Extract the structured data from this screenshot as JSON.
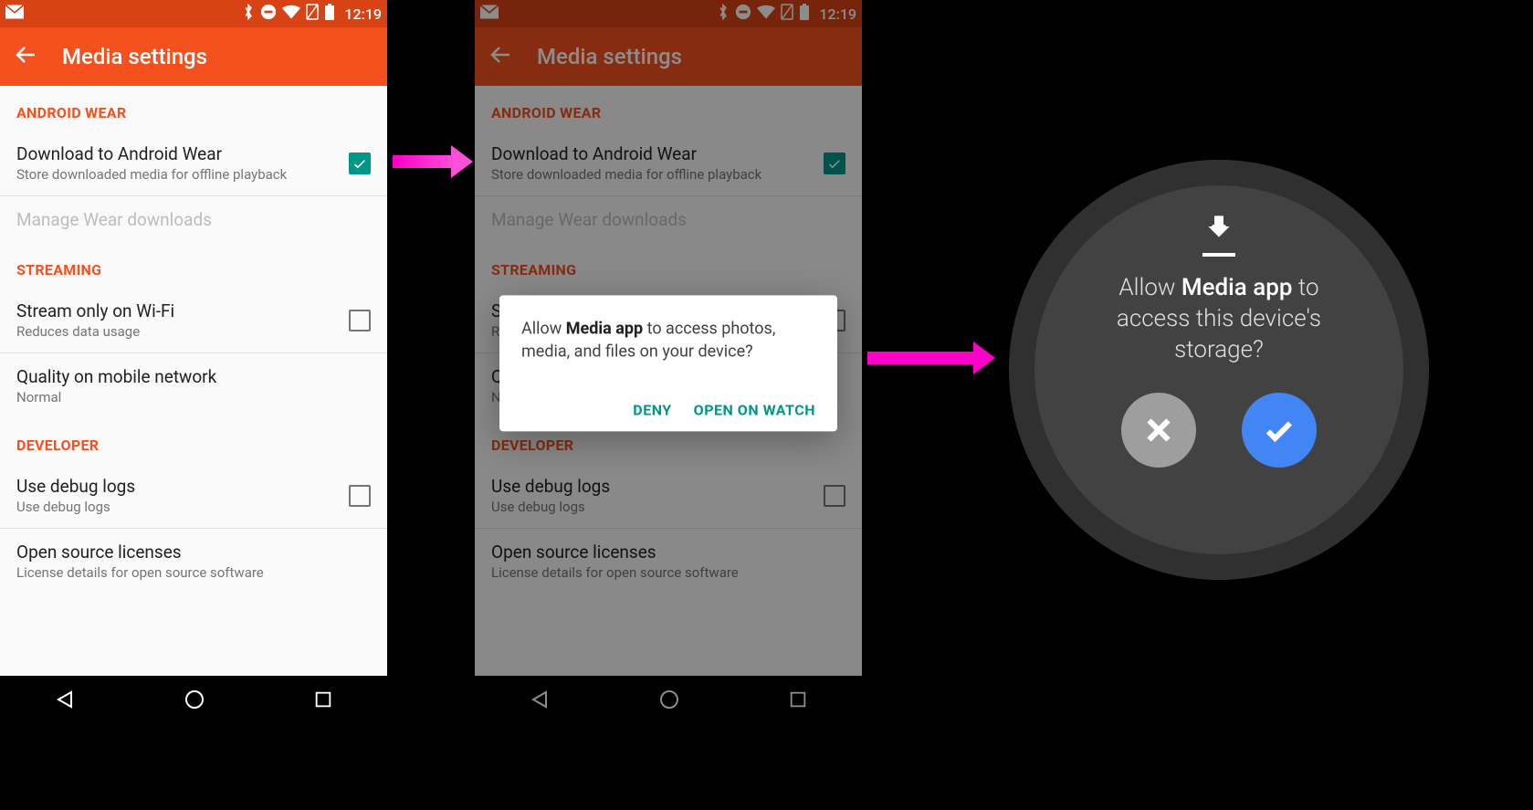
{
  "status": {
    "time": "12:19"
  },
  "appbar": {
    "title": "Media settings"
  },
  "sections": {
    "wear": {
      "header": "ANDROID WEAR",
      "download": {
        "title": "Download to Android Wear",
        "sub": "Store downloaded media for offline playback",
        "checked": true
      },
      "manage": {
        "title": "Manage Wear downloads"
      }
    },
    "streaming": {
      "header": "STREAMING",
      "wifi": {
        "title": "Stream only on Wi-Fi",
        "sub": "Reduces data usage",
        "checked": false
      },
      "quality": {
        "title": "Quality on mobile network",
        "sub": "Normal"
      }
    },
    "dev": {
      "header": "DEVELOPER",
      "debug": {
        "title": "Use debug logs",
        "sub": "Use debug logs",
        "checked": false
      },
      "oss": {
        "title": "Open source licenses",
        "sub": "License details for open source software"
      }
    }
  },
  "dialog": {
    "pre": "Allow ",
    "app": "Media app",
    "post": " to access photos, media, and files on your device?",
    "deny": "Deny",
    "open": "Open on watch"
  },
  "watch": {
    "pre": "Allow ",
    "app": "Media app",
    "post1": " to",
    "line2": "access this device's",
    "line3": "storage?"
  }
}
